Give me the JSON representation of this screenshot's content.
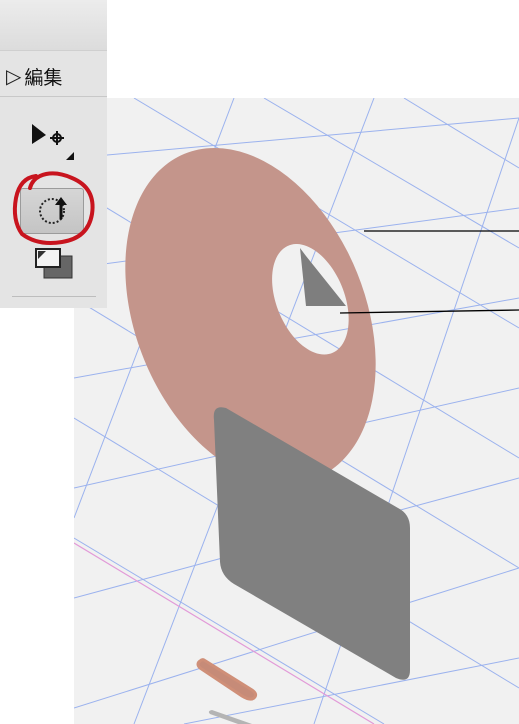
{
  "palette": {
    "title": "編集",
    "tools": [
      {
        "name": "move-tool",
        "icon": "arrow-move-icon"
      },
      {
        "name": "rotate-tool",
        "icon": "rotate-icon",
        "selected": true
      },
      {
        "name": "scale-tool",
        "icon": "scale-icon"
      }
    ]
  },
  "colors": {
    "disc": "#c4958b",
    "plate": "#808080",
    "grid": "#9bb2ee",
    "axis_x": "#e29ad8",
    "annotation_circle": "#c8141e",
    "viewport_bg": "#f1f1f1"
  },
  "scene": {
    "objects": [
      "disc-with-hole",
      "square-plate",
      "small-disc-preview",
      "small-plate-preview"
    ],
    "callout_lines": 2
  }
}
